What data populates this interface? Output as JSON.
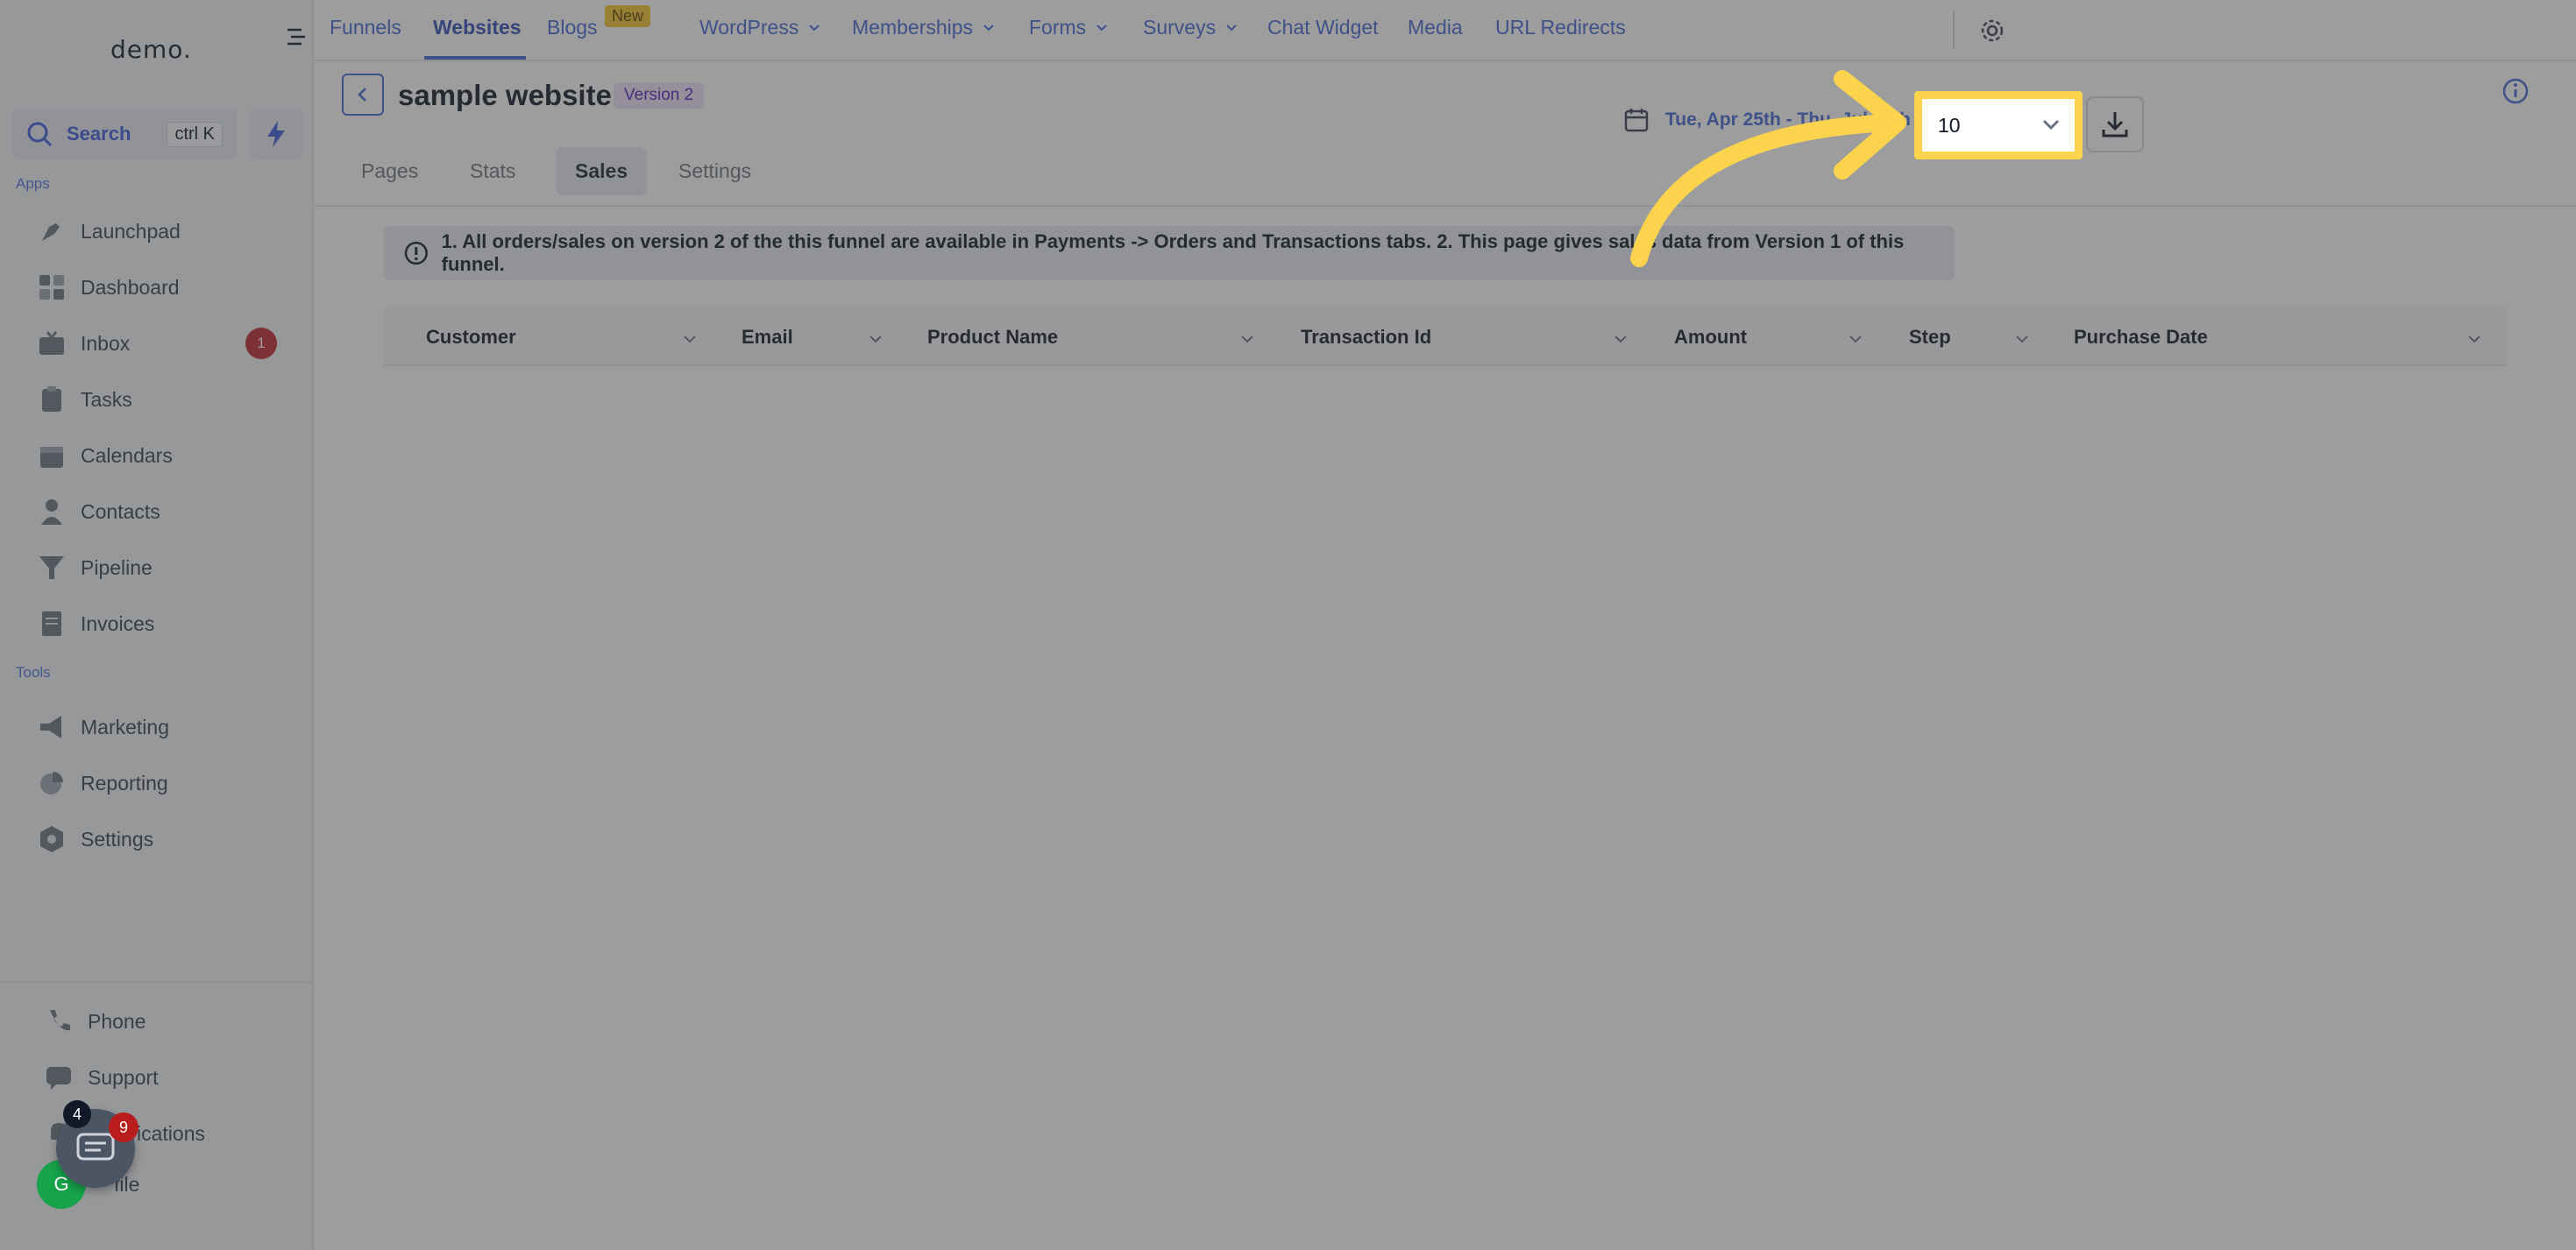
{
  "sidebar": {
    "logo": "demo.",
    "search_label": "Search",
    "search_shortcut": "ctrl K",
    "apps_label": "Apps",
    "tools_label": "Tools",
    "apps": [
      {
        "label": "Launchpad",
        "icon": "rocket-icon"
      },
      {
        "label": "Dashboard",
        "icon": "grid-icon"
      },
      {
        "label": "Inbox",
        "icon": "inbox-icon",
        "badge": "1"
      },
      {
        "label": "Tasks",
        "icon": "clipboard-icon"
      },
      {
        "label": "Calendars",
        "icon": "calendar-icon"
      },
      {
        "label": "Contacts",
        "icon": "person-icon"
      },
      {
        "label": "Pipeline",
        "icon": "funnel-icon"
      },
      {
        "label": "Invoices",
        "icon": "invoice-icon"
      }
    ],
    "tools": [
      {
        "label": "Marketing",
        "icon": "megaphone-icon"
      },
      {
        "label": "Reporting",
        "icon": "pie-chart-icon"
      },
      {
        "label": "Settings",
        "icon": "gear-icon"
      }
    ],
    "bottom": [
      {
        "label": "Phone",
        "icon": "phone-icon"
      },
      {
        "label": "Support",
        "icon": "chat-bubble-icon"
      },
      {
        "label": "ications",
        "icon": "bell-icon"
      },
      {
        "label": "file",
        "icon": "avatar-icon"
      }
    ],
    "avatar_initials": "G",
    "chat_badge_count": "9",
    "notification_count": "4"
  },
  "topnav": {
    "items": [
      {
        "label": "Funnels"
      },
      {
        "label": "Websites",
        "active": true
      },
      {
        "label": "Blogs"
      },
      {
        "label": "WordPress",
        "dropdown": true
      },
      {
        "label": "Memberships",
        "dropdown": true
      },
      {
        "label": "Forms",
        "dropdown": true
      },
      {
        "label": "Surveys",
        "dropdown": true
      },
      {
        "label": "Chat Widget"
      },
      {
        "label": "Media"
      },
      {
        "label": "URL Redirects"
      }
    ],
    "new_badge": "New"
  },
  "header": {
    "title": "sample website",
    "version_badge": "Version 2",
    "date_range": "Tue, Apr 25th - Thu, Jul 13th",
    "page_size": "10"
  },
  "subtabs": [
    {
      "label": "Pages"
    },
    {
      "label": "Stats"
    },
    {
      "label": "Sales",
      "active": true
    },
    {
      "label": "Settings"
    }
  ],
  "notice": "1. All orders/sales on version 2 of the this funnel are available in Payments -> Orders and Transactions tabs.   2. This page gives sales data from Version 1 of this funnel.",
  "table": {
    "columns": [
      "Customer",
      "Email",
      "Product Name",
      "Transaction Id",
      "Amount",
      "Step",
      "Purchase Date"
    ]
  },
  "colors": {
    "accent": "#4267d6",
    "highlight": "#fcd34d",
    "badge_red": "#c0262d"
  }
}
